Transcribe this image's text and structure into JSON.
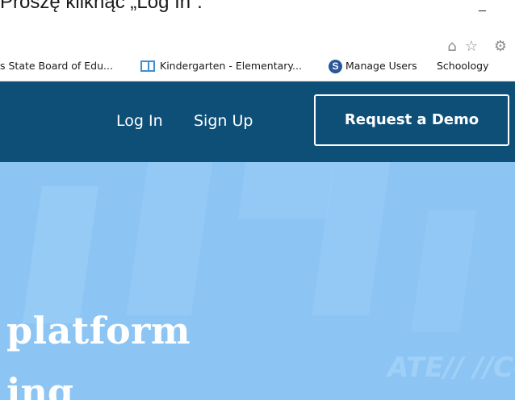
{
  "instruction": {
    "text": "Proszę kliknąć „Log In”.",
    "minimize": "_"
  },
  "toolbar": {
    "icons": [
      {
        "name": "home-icon",
        "glyph": "⌂"
      },
      {
        "name": "favorites-star-icon",
        "glyph": "☆"
      },
      {
        "name": "settings-gear-icon",
        "glyph": "⚙"
      }
    ]
  },
  "favorites": [
    {
      "label": "s State Board of Edu...",
      "icon": "none"
    },
    {
      "label": "Kindergarten - Elementary...",
      "icon": "page-icon"
    },
    {
      "label": "Manage Users",
      "icon": "schoology-s-icon",
      "icon_letter": "S"
    },
    {
      "label": "Schoology",
      "icon": "none"
    }
  ],
  "header": {
    "background": "#0e4f78",
    "login_label": "Log In",
    "signup_label": "Sign Up",
    "demo_label": "Request a Demo"
  },
  "hero": {
    "background": "#8cc5f4",
    "line1": "platform",
    "line2": "ing",
    "watermark": "ATE// //CO"
  }
}
